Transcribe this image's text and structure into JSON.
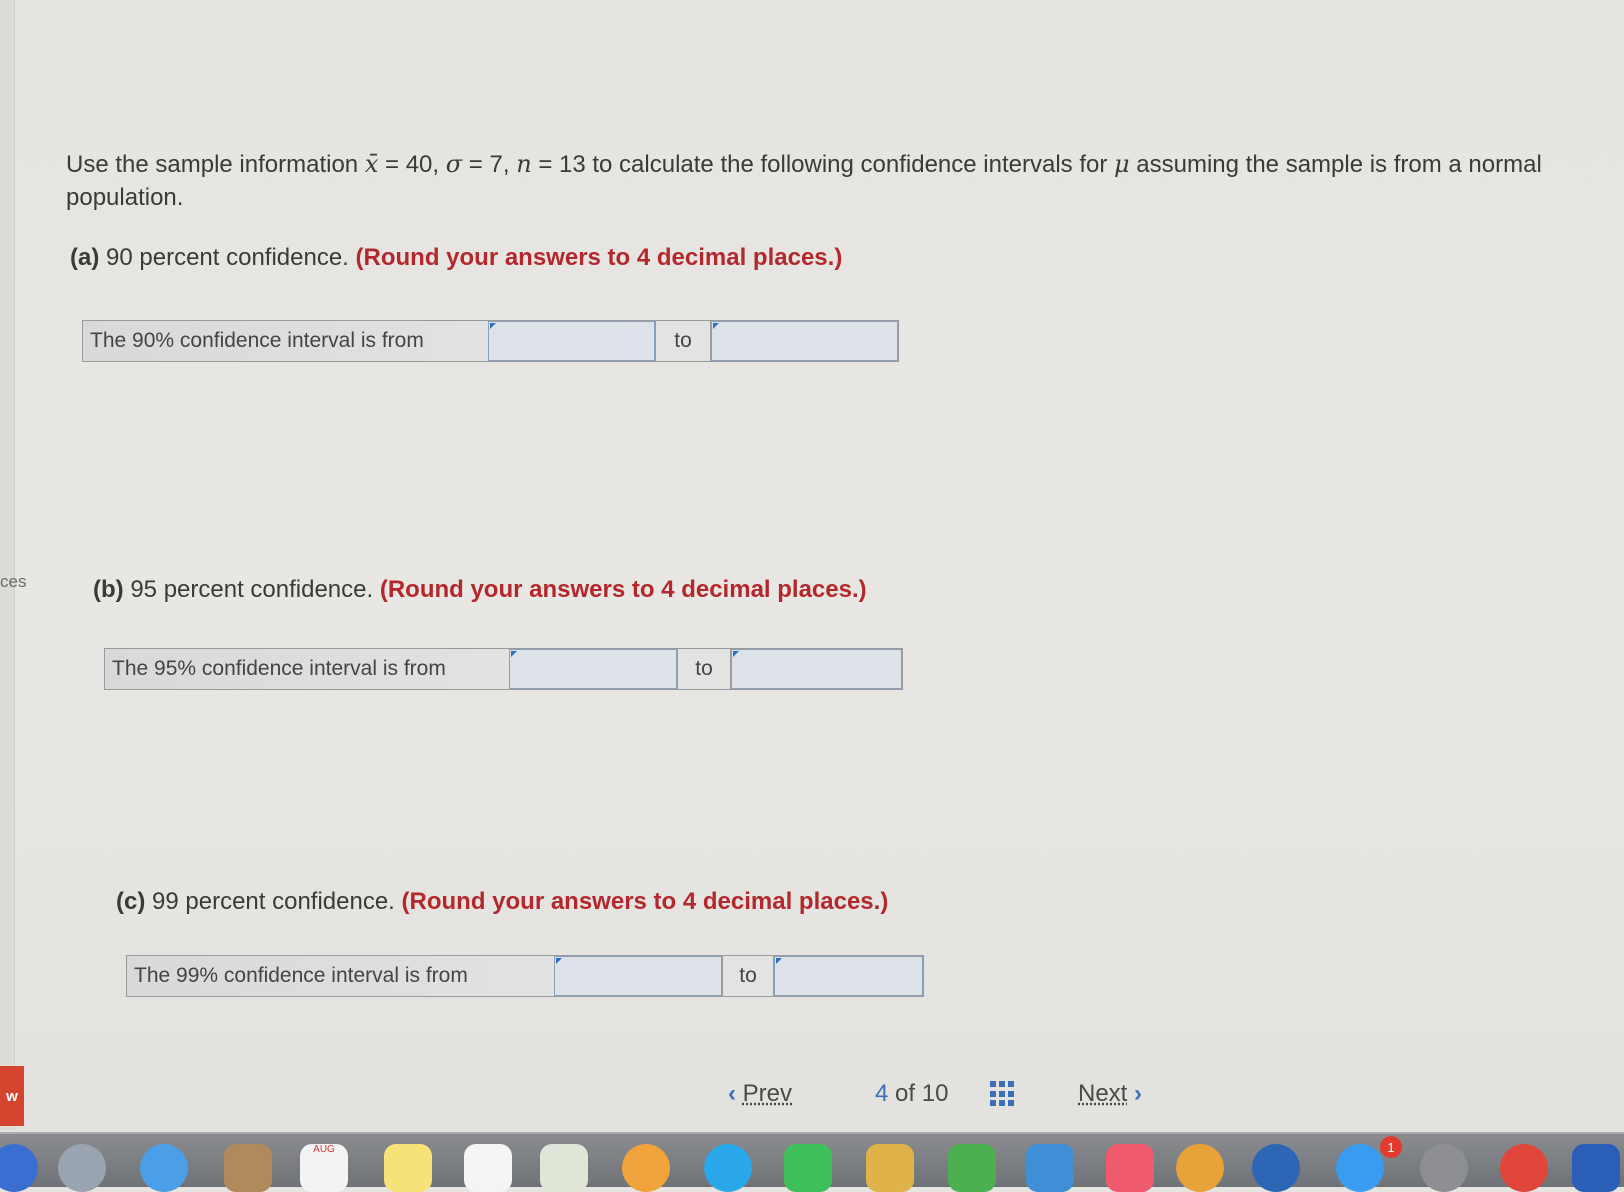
{
  "sidebar": {
    "label": "ces",
    "badge": "w"
  },
  "question": {
    "intro": "Use the sample information ",
    "xbar": "x̄",
    "xbar_value": " = 40, ",
    "sigma": "σ",
    "sigma_value": " = 7, ",
    "n": "n",
    "n_value": " = 13 to calculate the following confidence intervals for ",
    "mu": "μ",
    "outro": " assuming the sample is from a normal population."
  },
  "parts": [
    {
      "letter": "(a)",
      "text": " 90 percent confidence. ",
      "round": "(Round your answers to 4 decimal places.)",
      "ci_label": "The 90% confidence interval is from",
      "to": "to",
      "lower_value": "",
      "upper_value": ""
    },
    {
      "letter": "(b)",
      "text": " 95 percent confidence. ",
      "round": "(Round your answers to 4 decimal places.)",
      "ci_label": "The 95% confidence interval is from",
      "to": "to",
      "lower_value": "",
      "upper_value": ""
    },
    {
      "letter": "(c)",
      "text": " 99 percent confidence. ",
      "round": "(Round your answers to 4 decimal places.)",
      "ci_label": "The 99% confidence interval is from",
      "to": "to",
      "lower_value": "",
      "upper_value": ""
    }
  ],
  "nav": {
    "prev_icon": "chevron-left-icon",
    "prev": "Prev",
    "page_current": "4",
    "page_of": "of",
    "page_total": "10",
    "grid_icon": "grid-icon",
    "next": "Next",
    "next_icon": "chevron-right-icon"
  },
  "dock": {
    "calendar_label": "AUG",
    "notification_count": "1"
  },
  "colors": {
    "accent": "#3b6fb8",
    "round_note": "#b3282d",
    "input_border": "#8aa2bd"
  }
}
